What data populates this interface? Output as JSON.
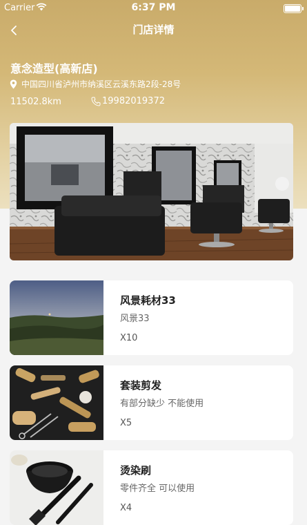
{
  "status_bar": {
    "carrier": "Carrier",
    "time": "6:37 PM"
  },
  "nav": {
    "title": "门店详情",
    "back_icon": "chevron-left-icon"
  },
  "store": {
    "name": "意念造型(高新店)",
    "address": "中国四川省泸州市纳溪区云溪东路2段-28号",
    "distance": "11502.8km",
    "phone": "19982019372"
  },
  "items": [
    {
      "title": "风景耗材33",
      "desc": "风景33",
      "qty": "X10"
    },
    {
      "title": "套装剪发",
      "desc": "有部分缺少 不能使用",
      "qty": "X5"
    },
    {
      "title": "烫染刷",
      "desc": "零件齐全 可以使用",
      "qty": "X4"
    }
  ],
  "colors": {
    "header_gold": "#c9ab6a",
    "page_bg": "#f4f4f4"
  }
}
